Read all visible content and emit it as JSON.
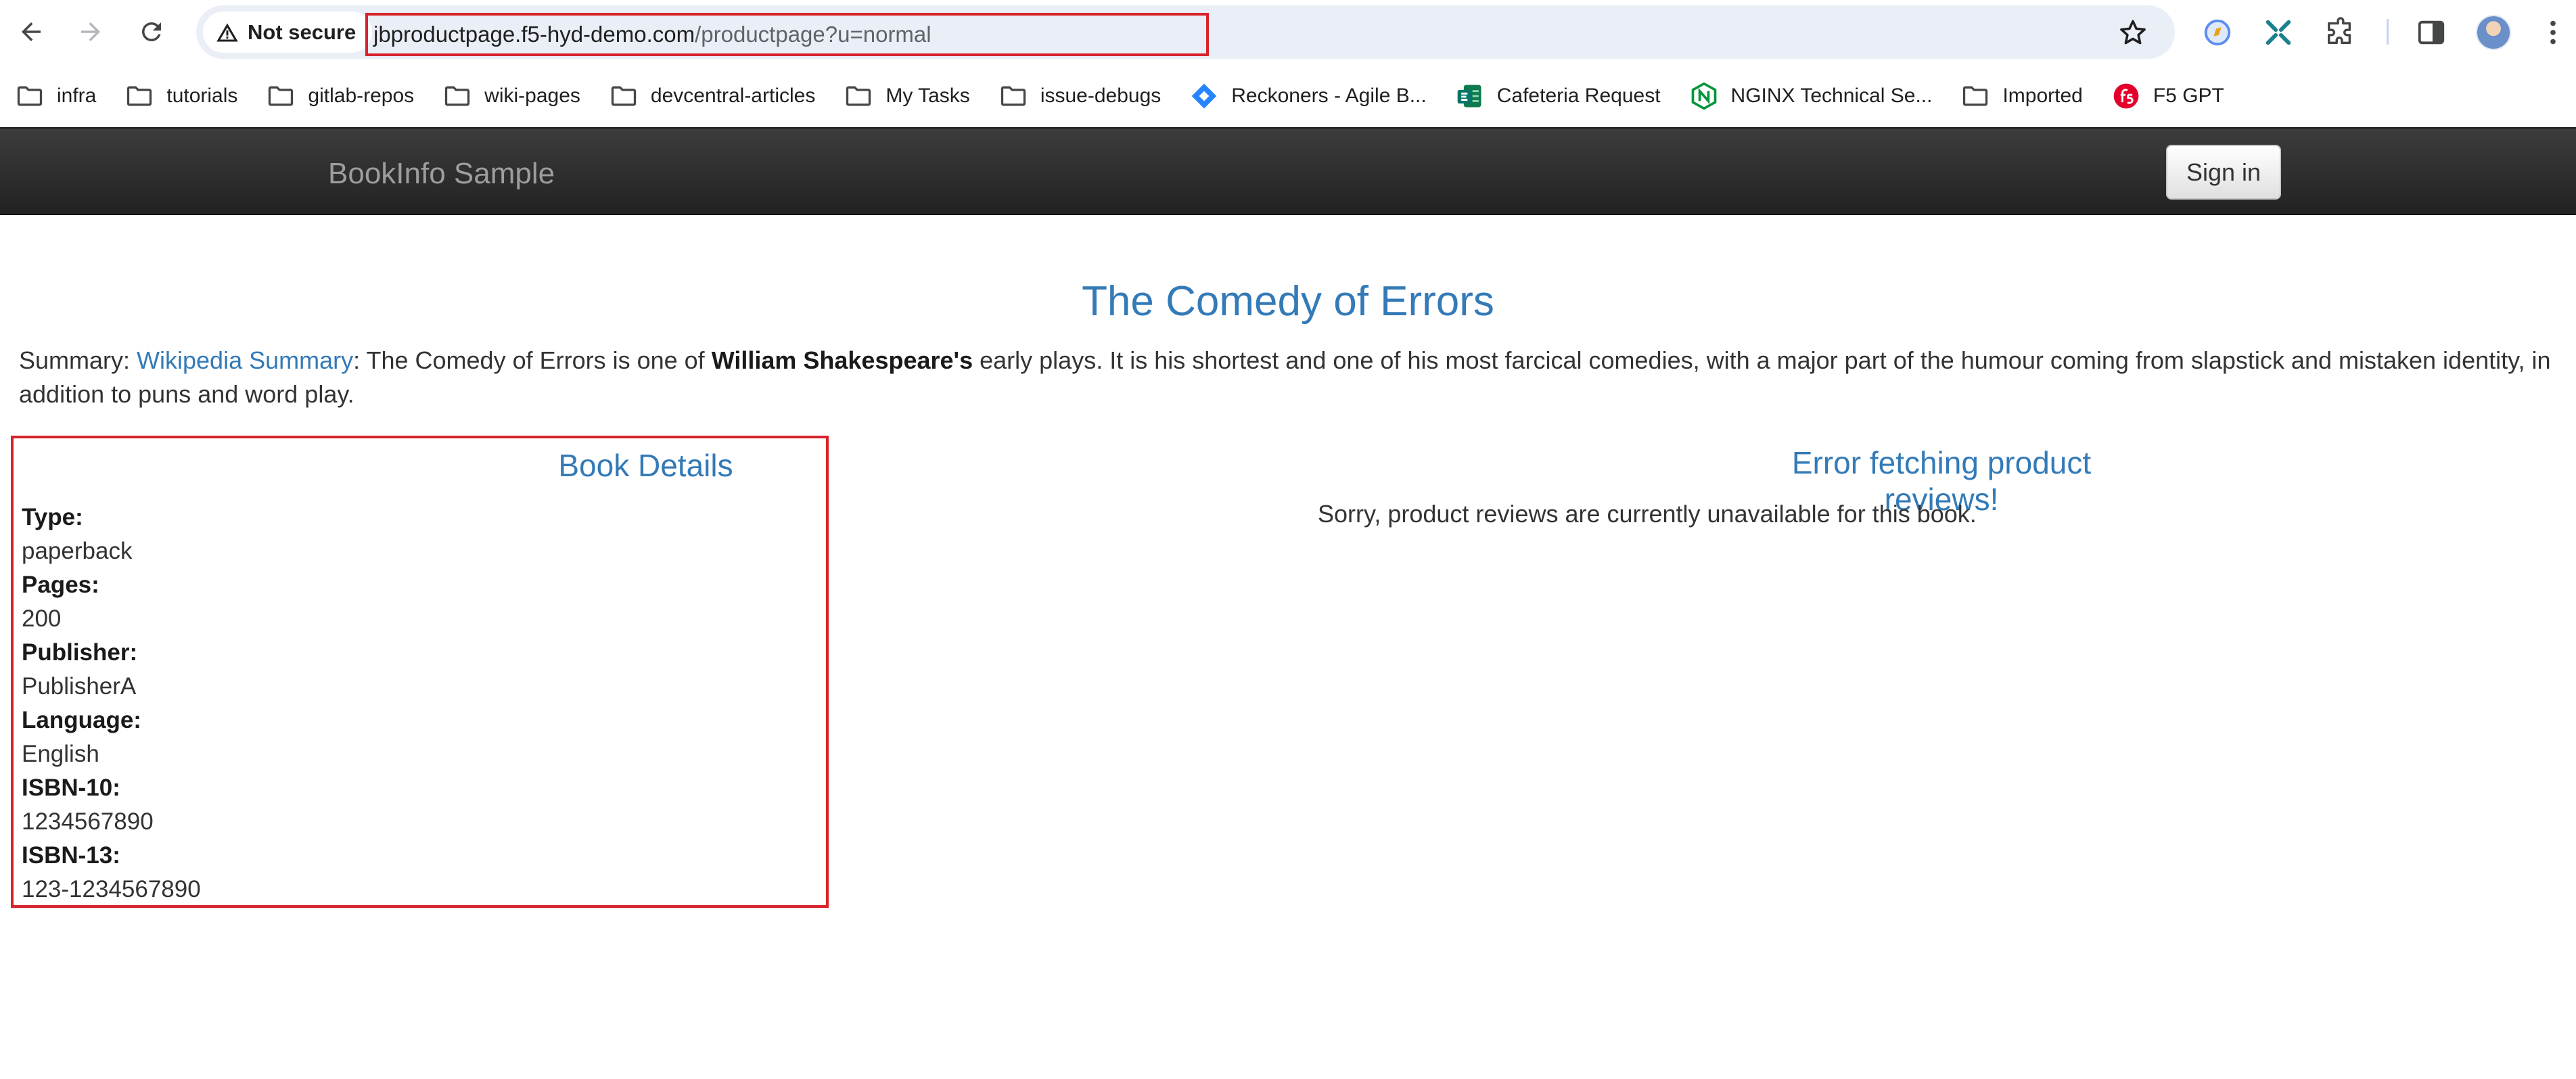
{
  "browser": {
    "security_label": "Not secure",
    "url_host": "jbproductpage.f5-hyd-demo.com",
    "url_path": "/productpage?u=normal",
    "highlight_color": "#d8232a"
  },
  "bookmarks": [
    {
      "label": "infra",
      "icon": "folder-icon"
    },
    {
      "label": "tutorials",
      "icon": "folder-icon"
    },
    {
      "label": "gitlab-repos",
      "icon": "folder-icon"
    },
    {
      "label": "wiki-pages",
      "icon": "folder-icon"
    },
    {
      "label": "devcentral-articles",
      "icon": "folder-icon"
    },
    {
      "label": "My Tasks",
      "icon": "folder-icon"
    },
    {
      "label": "issue-debugs",
      "icon": "folder-icon"
    },
    {
      "label": "Reckoners - Agile B...",
      "icon": "jira-icon"
    },
    {
      "label": "Cafeteria Request",
      "icon": "forms-icon"
    },
    {
      "label": "NGINX Technical Se...",
      "icon": "nginx-icon"
    },
    {
      "label": "Imported",
      "icon": "folder-icon"
    },
    {
      "label": "F5 GPT",
      "icon": "f5-icon"
    }
  ],
  "app": {
    "brand": "BookInfo Sample",
    "signin_label": "Sign in",
    "navbar_color": "#222222",
    "link_color": "#337ab7"
  },
  "product": {
    "title": "The Comedy of Errors",
    "summary_prefix": "Summary: ",
    "summary_link": "Wikipedia Summary",
    "summary_middle": ": The Comedy of Errors is one of ",
    "summary_author": "William Shakespeare's",
    "summary_rest": " early plays. It is his shortest and one of his most farcical comedies, with a major part of the humour coming from slapstick and mistaken identity, in addition to puns and word play."
  },
  "details": {
    "heading": "Book Details",
    "type_label": "Type:",
    "type_value": "paperback",
    "pages_label": "Pages:",
    "pages_value": "200",
    "publisher_label": "Publisher:",
    "publisher_value": "PublisherA",
    "language_label": "Language:",
    "language_value": "English",
    "isbn10_label": "ISBN-10:",
    "isbn10_value": "1234567890",
    "isbn13_label": "ISBN-13:",
    "isbn13_value": "123-1234567890"
  },
  "reviews": {
    "heading": "Error fetching product reviews!",
    "message": "Sorry, product reviews are currently unavailable for this book."
  }
}
